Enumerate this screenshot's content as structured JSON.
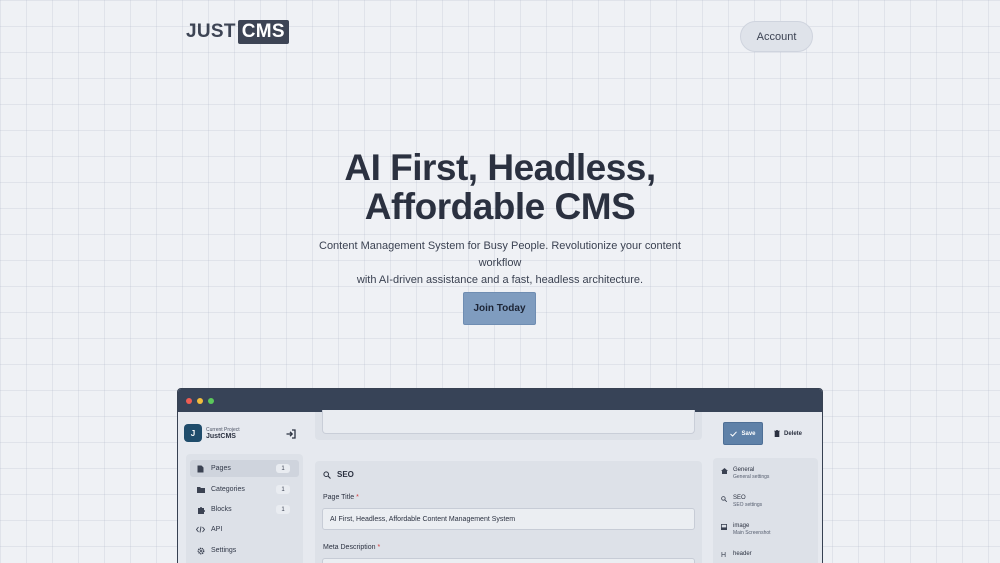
{
  "brand": {
    "part1": "JUST",
    "part2": "CMS"
  },
  "header": {
    "account_label": "Account"
  },
  "hero": {
    "title_line1": "AI First, Headless,",
    "title_line2": "Affordable CMS",
    "subtitle_line1": "Content Management System for Busy People. Revolutionize your content workflow",
    "subtitle_line2": "with AI-driven assistance and a fast, headless architecture.",
    "cta_label": "Join Today"
  },
  "app": {
    "project_label": "Current Project",
    "project_name": "JustCMS",
    "project_initial": "J",
    "nav": [
      {
        "label": "Pages",
        "icon": "page-icon",
        "badge": "1"
      },
      {
        "label": "Categories",
        "icon": "folder-icon",
        "badge": "1"
      },
      {
        "label": "Blocks",
        "icon": "puzzle-icon",
        "badge": "1"
      },
      {
        "label": "API",
        "icon": "code-icon"
      },
      {
        "label": "Settings",
        "icon": "gear-icon"
      }
    ],
    "seo": {
      "heading": "SEO",
      "page_title_label": "Page Title",
      "page_title_value": "AI First, Headless, Affordable Content Management System",
      "meta_description_label": "Meta Description"
    },
    "actions": {
      "save_label": "Save",
      "delete_label": "Delete"
    },
    "right_panel": [
      {
        "title": "General",
        "sub": "General settings",
        "icon": "home-icon"
      },
      {
        "title": "SEO",
        "sub": "SEO settings",
        "icon": "search-icon"
      },
      {
        "title": "image",
        "sub": "Main Screenshot",
        "icon": "image-icon"
      },
      {
        "title": "header",
        "sub": "",
        "icon": "heading-icon"
      }
    ]
  },
  "colors": {
    "accent": "#7f9cbf",
    "save": "#5f81a8",
    "titlebar": "#374357"
  }
}
